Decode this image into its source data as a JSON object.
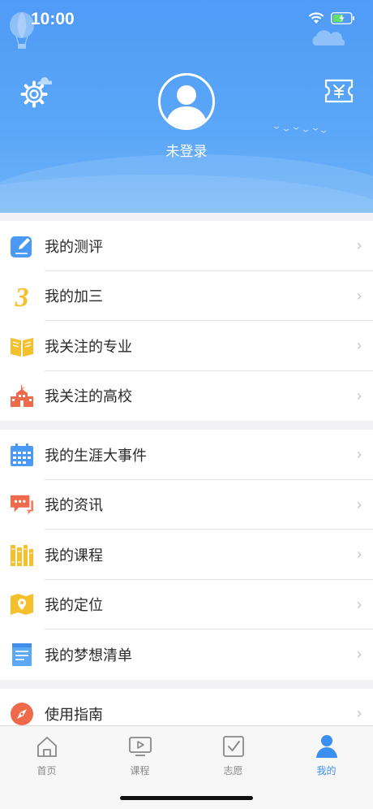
{
  "status_bar": {
    "time": "10:00"
  },
  "profile": {
    "login_label": "未登录"
  },
  "groups": [
    {
      "items": [
        {
          "label": "我的测评",
          "icon": "edit-icon",
          "color": "#4a9af5"
        },
        {
          "label": "我的加三",
          "icon": "number-three-icon",
          "color": "#f5c02c"
        },
        {
          "label": "我关注的专业",
          "icon": "book-icon",
          "color": "#f5c02c"
        },
        {
          "label": "我关注的高校",
          "icon": "school-icon",
          "color": "#ee6a4a"
        }
      ]
    },
    {
      "items": [
        {
          "label": "我的生涯大事件",
          "icon": "calendar-icon",
          "color": "#4a9af5"
        },
        {
          "label": "我的资讯",
          "icon": "chat-icon",
          "color": "#ee6a4a"
        },
        {
          "label": "我的课程",
          "icon": "books-icon",
          "color": "#f5c02c"
        },
        {
          "label": "我的定位",
          "icon": "map-pin-icon",
          "color": "#f5c02c"
        },
        {
          "label": "我的梦想清单",
          "icon": "list-icon",
          "color": "#5aa8f6"
        }
      ]
    },
    {
      "items": [
        {
          "label": "使用指南",
          "icon": "compass-icon",
          "color": "#ee6a4a"
        }
      ]
    }
  ],
  "tabbar": {
    "tabs": [
      {
        "label": "首页",
        "icon": "home-icon"
      },
      {
        "label": "课程",
        "icon": "video-icon"
      },
      {
        "label": "志愿",
        "icon": "checkbox-icon"
      },
      {
        "label": "我的",
        "icon": "person-icon",
        "active": true
      }
    ]
  },
  "colors": {
    "header": "#4f9bf6",
    "accent": "#3b8ff0"
  }
}
